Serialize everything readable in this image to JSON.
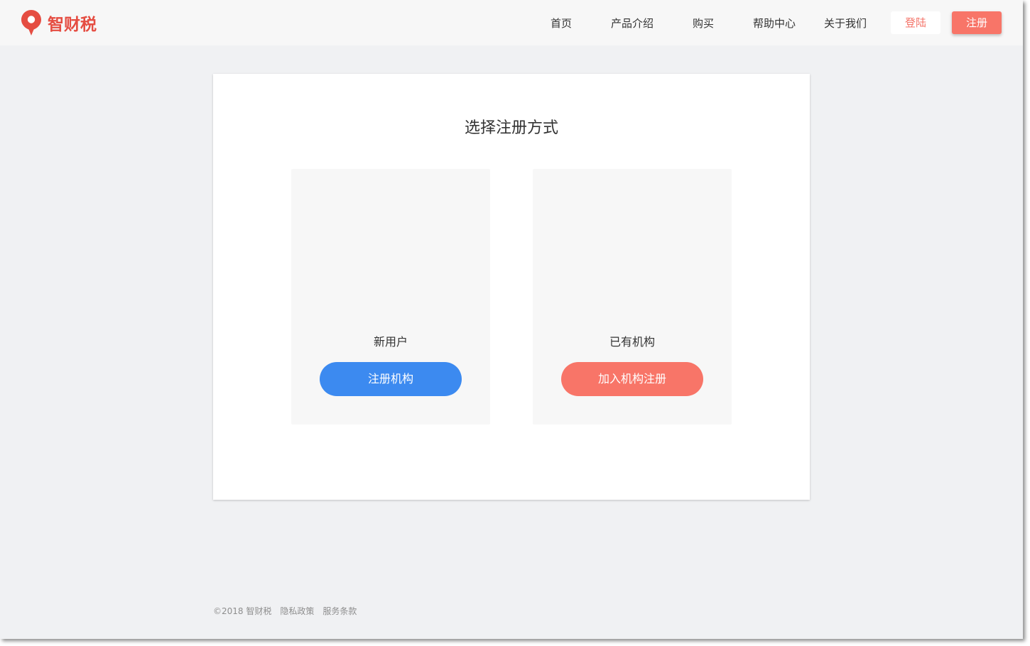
{
  "brand": {
    "name": "智财税",
    "color": "#e54d42"
  },
  "nav": {
    "items": [
      {
        "label": "首页"
      },
      {
        "label": "产品介绍"
      },
      {
        "label": "购买"
      },
      {
        "label": "帮助中心"
      },
      {
        "label": "关于我们"
      }
    ],
    "login_label": "登陆",
    "register_label": "注册"
  },
  "main": {
    "title": "选择注册方式",
    "options": [
      {
        "label": "新用户",
        "button": "注册机构",
        "color": "#3c8af0"
      },
      {
        "label": "已有机构",
        "button": "加入机构注册",
        "color": "#f87568"
      }
    ]
  },
  "footer": {
    "copyright": "©2018 智财税",
    "privacy": "隐私政策",
    "terms": "服务条款"
  }
}
